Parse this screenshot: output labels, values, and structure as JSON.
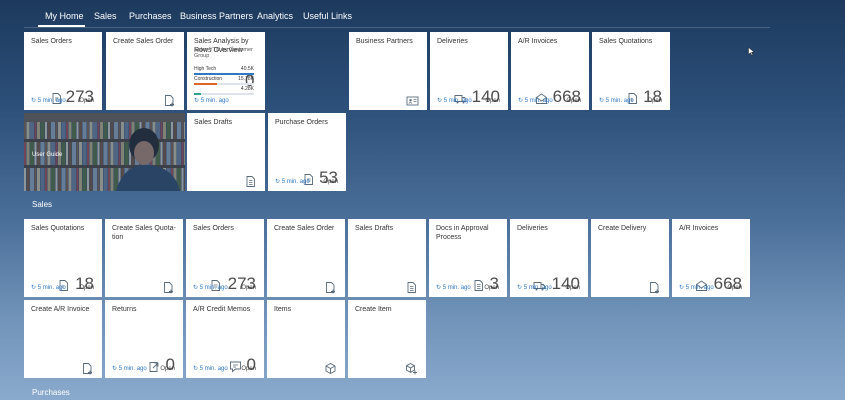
{
  "nav": {
    "items": [
      "My Home",
      "Sales",
      "Purchases",
      "Business Partners",
      "Analytics",
      "Useful Links"
    ]
  },
  "common": {
    "refreshed": "5 min. ago",
    "status": "Open"
  },
  "home": {
    "tiles": {
      "sales_orders": {
        "title": "Sales Orders",
        "value": "273",
        "icon": "document-icon"
      },
      "create_sales_order": {
        "title": "Create Sales Order",
        "icon": "create-document-icon"
      },
      "sales_analysis": {
        "title": "Sales Analysis by Rows Overview",
        "subtitle": "Sales YTD by Customer Group",
        "value": "0",
        "bars": [
          {
            "label": "High Tech",
            "value": "40.5K",
            "fraction": 1.0,
            "color": "#2f78c4"
          },
          {
            "label": "Construction",
            "value": "15.78K",
            "fraction": 0.39,
            "color": "#e0642a"
          },
          {
            "label": "",
            "value": "4.28K",
            "fraction": 0.11,
            "color": "#2ca58d"
          }
        ]
      },
      "business_partners": {
        "title": "Business Partners",
        "icon": "contact-card-icon"
      },
      "deliveries": {
        "title": "Deliveries",
        "value": "140",
        "icon": "truck-icon"
      },
      "ar_invoices": {
        "title": "A/R Invoices",
        "value": "668",
        "icon": "envelope-icon"
      },
      "sales_quotations": {
        "title": "Sales Quotations",
        "value": "18",
        "icon": "quotation-icon"
      },
      "user_guide": {
        "title": "User Guide"
      },
      "sales_drafts": {
        "title": "Sales Drafts",
        "icon": "draft-icon"
      },
      "purchase_orders": {
        "title": "Purchase Orders",
        "value": "53",
        "icon": "document-icon"
      }
    }
  },
  "sales": {
    "title": "Sales",
    "row1": [
      {
        "id": "sales-quotations",
        "title": "Sales Quotations",
        "value": "18",
        "icon": "quotation-icon",
        "footer": true
      },
      {
        "id": "create-sales-quotation",
        "title": "Create Sales Quota-tion",
        "icon": "create-document-icon",
        "footer": false
      },
      {
        "id": "sales-orders",
        "title": "Sales Orders",
        "value": "273",
        "icon": "document-icon",
        "footer": true
      },
      {
        "id": "create-sales-order",
        "title": "Create Sales Order",
        "icon": "create-document-icon",
        "footer": false
      },
      {
        "id": "sales-drafts",
        "title": "Sales Drafts",
        "icon": "draft-icon",
        "footer": false
      },
      {
        "id": "docs-in-approval",
        "title": "Docs in Approval Process",
        "value": "3",
        "icon": "draft-icon",
        "footer": true
      },
      {
        "id": "deliveries",
        "title": "Deliveries",
        "value": "140",
        "icon": "truck-icon",
        "footer": true
      },
      {
        "id": "create-delivery",
        "title": "Create Delivery",
        "icon": "create-document-icon",
        "footer": false
      },
      {
        "id": "ar-invoices",
        "title": "A/R Invoices",
        "value": "668",
        "icon": "envelope-icon",
        "footer": true
      }
    ],
    "row2": [
      {
        "id": "create-ar-invoice",
        "title": "Create A/R Invoice",
        "icon": "create-document-icon",
        "footer": false
      },
      {
        "id": "returns",
        "title": "Returns",
        "value": "0",
        "icon": "return-icon",
        "footer": true
      },
      {
        "id": "ar-credit-memos",
        "title": "A/R Credit Memos",
        "value": "0",
        "icon": "memo-icon",
        "footer": true
      },
      {
        "id": "items",
        "title": "Items",
        "icon": "cube-icon",
        "footer": false
      },
      {
        "id": "create-item",
        "title": "Create Item",
        "icon": "create-cube-icon",
        "footer": false
      }
    ]
  },
  "purchases": {
    "title": "Purchases"
  }
}
